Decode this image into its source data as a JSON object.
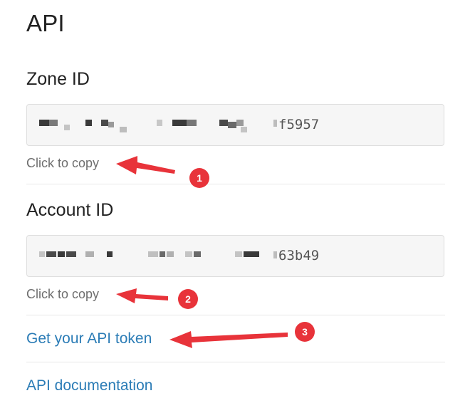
{
  "section": {
    "title": "API"
  },
  "zone": {
    "heading": "Zone ID",
    "value_suffix": "f5957",
    "copy_hint": "Click to copy"
  },
  "account": {
    "heading": "Account ID",
    "value_suffix": "63b49",
    "copy_hint": "Click to copy"
  },
  "links": {
    "api_token": "Get your API token",
    "api_docs": "API documentation"
  },
  "annotations": {
    "color": "#e8333a",
    "badges": [
      "1",
      "2",
      "3"
    ]
  }
}
